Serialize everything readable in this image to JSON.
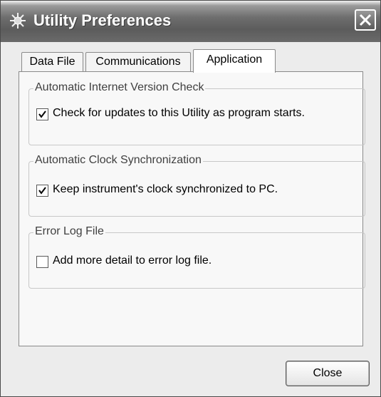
{
  "window": {
    "title": "Utility Preferences",
    "title_icon": "gear-burst-icon",
    "close_icon": "close-icon"
  },
  "tabs": [
    {
      "label": "Data File",
      "active": false
    },
    {
      "label": "Communications",
      "active": false
    },
    {
      "label": "Application",
      "active": true
    }
  ],
  "groups": [
    {
      "title": "Automatic Internet Version Check",
      "option": {
        "label": "Check for updates to this Utility as program starts.",
        "checked": true
      }
    },
    {
      "title": "Automatic Clock Synchronization",
      "option": {
        "label": "Keep instrument's clock synchronized to PC.",
        "checked": true
      }
    },
    {
      "title": "Error Log File",
      "option": {
        "label": "Add more detail to error log file.",
        "checked": false
      }
    }
  ],
  "buttons": {
    "close_label": "Close"
  }
}
